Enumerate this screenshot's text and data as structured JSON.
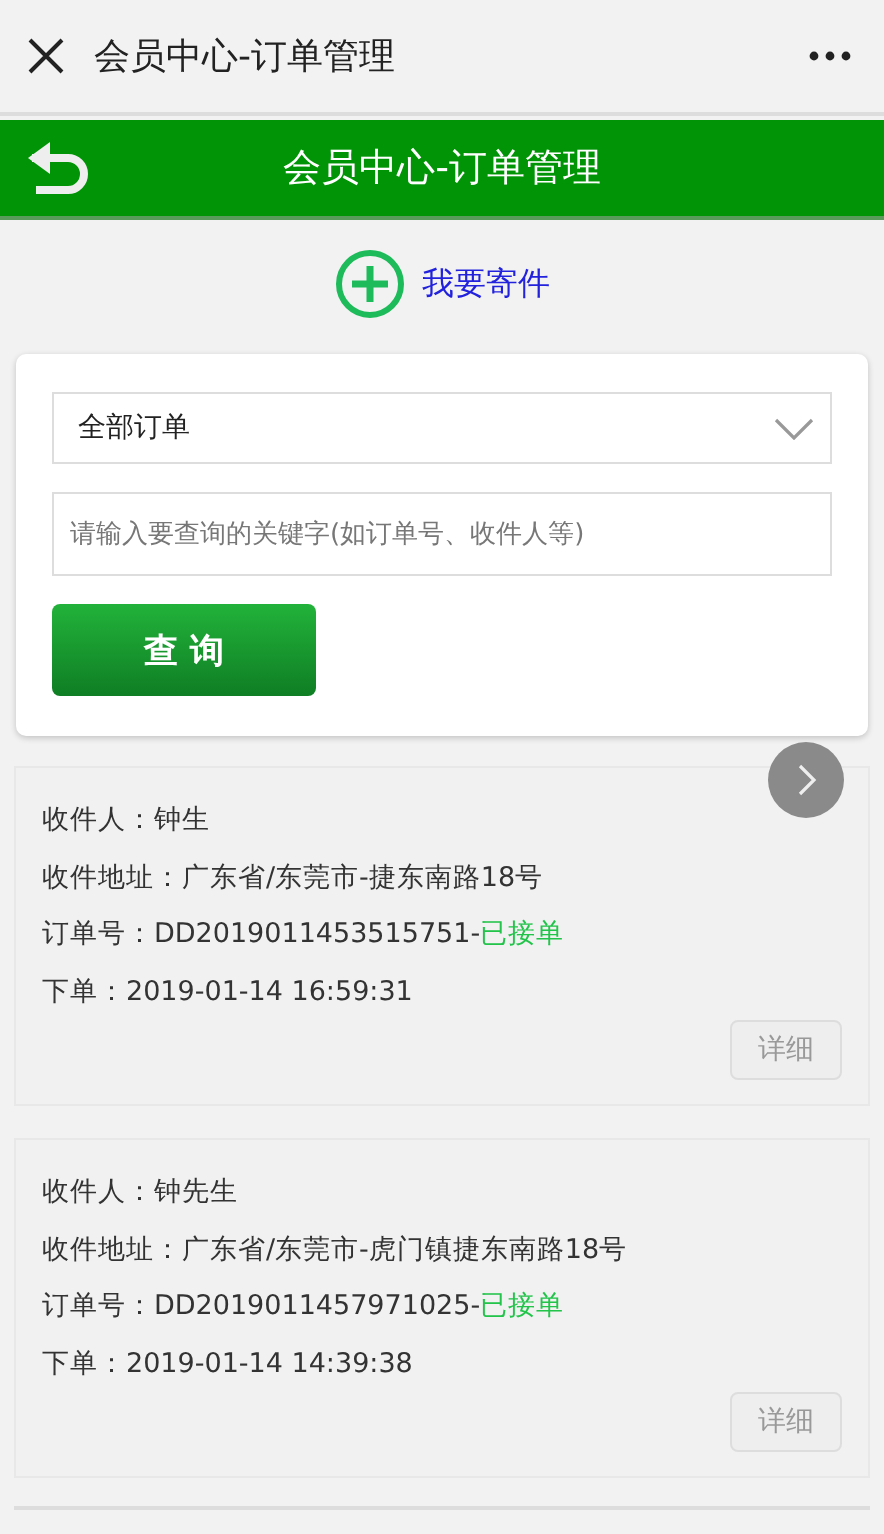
{
  "top_bar": {
    "title": "会员中心-订单管理"
  },
  "header": {
    "title": "会员中心-订单管理"
  },
  "send_link": {
    "label": "我要寄件"
  },
  "search": {
    "select_value": "全部订单",
    "placeholder": "请输入要查询的关键字(如订单号、收件人等)",
    "button": "查 询"
  },
  "orders": [
    {
      "recipient": "收件人：钟生",
      "address": "收件地址：广东省/东莞市-捷东南路18号",
      "order_no": "订单号：DD2019011453515751-",
      "status": "已接单",
      "placed": "下单：2019-01-14 16:59:31",
      "detail_button": "详细"
    },
    {
      "recipient": "收件人：钟先生",
      "address": "收件地址：广东省/东莞市-虎门镇捷东南路18号",
      "order_no": "订单号：DD2019011457971025-",
      "status": "已接单",
      "placed": "下单：2019-01-14 14:39:38",
      "detail_button": "详细"
    }
  ]
}
